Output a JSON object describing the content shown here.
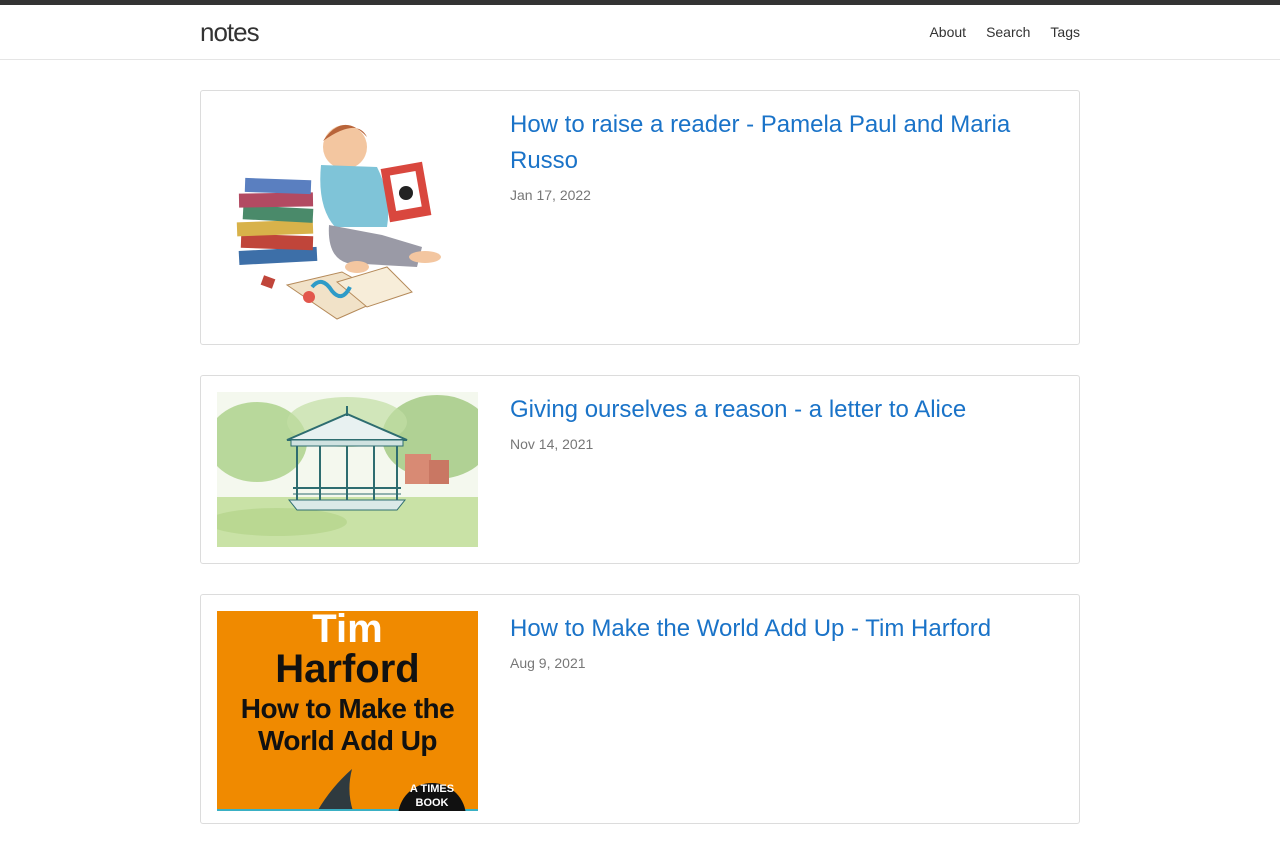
{
  "site": {
    "brand": "notes"
  },
  "nav": {
    "items": [
      {
        "label": "About"
      },
      {
        "label": "Search"
      },
      {
        "label": "Tags"
      }
    ]
  },
  "posts": [
    {
      "title": "How to raise a reader - Pamela Paul and Maria Russo",
      "date": "Jan 17, 2022",
      "image": "boy-reading-illustration"
    },
    {
      "title": "Giving ourselves a reason - a letter to Alice",
      "date": "Nov 14, 2021",
      "image": "bandstand-watercolor"
    },
    {
      "title": "How to Make the World Add Up - Tim Harford",
      "date": "Aug 9, 2021",
      "image": "book-cover",
      "cover": {
        "author_line1": "Tim",
        "author_line2": "Harford",
        "title_line1": "How to Make the",
        "title_line2": "World Add Up",
        "badge_line1": "A TIMES",
        "badge_line2": "BOOK"
      }
    }
  ],
  "colors": {
    "link": "#1a73c8",
    "cover_orange": "#f08a00"
  }
}
